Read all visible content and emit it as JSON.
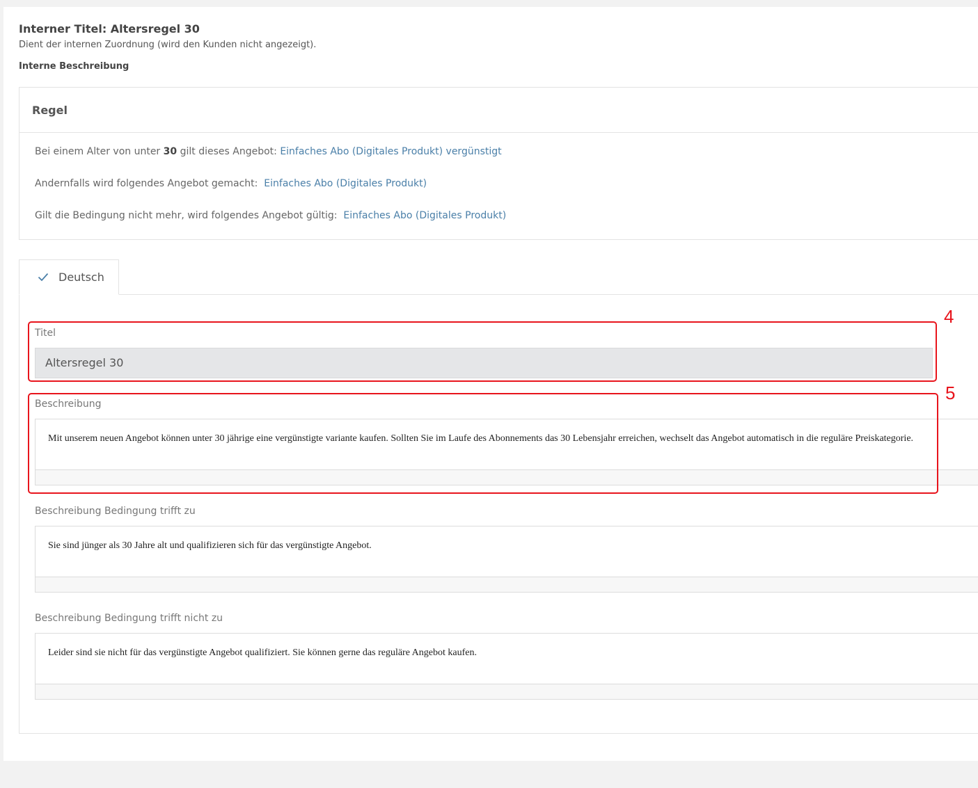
{
  "header": {
    "internal_title": "Interner Titel: Altersregel 30",
    "internal_title_hint": "Dient der internen Zuordnung (wird den Kunden nicht angezeigt).",
    "internal_description_label": "Interne Beschreibung"
  },
  "rule": {
    "heading": "Regel",
    "line1_prefix": "Bei einem Alter von unter",
    "line1_age": "30",
    "line1_mid": "gilt dieses Angebot:",
    "line1_link": "Einfaches Abo (Digitales Produkt) vergünstigt",
    "line2_text": "Andernfalls wird folgendes Angebot gemacht:",
    "line2_link": "Einfaches Abo (Digitales Produkt)",
    "line3_text": "Gilt die Bedingung nicht mehr, wird folgendes Angebot gültig:",
    "line3_link": "Einfaches Abo (Digitales Produkt)"
  },
  "tabs": [
    {
      "label": "Deutsch",
      "active": true
    }
  ],
  "form": {
    "title_label": "Titel",
    "title_value": "Altersregel 30",
    "description_label": "Beschreibung",
    "description_text": "Mit unserem neuen Angebot können unter 30 jährige eine vergünstigte variante kaufen. Sollten Sie im Laufe des Abonnements das 30 Lebensjahr erreichen, wechselt das Angebot automatisch in die reguläre Preiskategorie.",
    "cond_true_label": "Beschreibung Bedingung trifft zu",
    "cond_true_text": "Sie sind jünger als 30 Jahre alt und qualifizieren sich für das vergünstigte Angebot.",
    "cond_false_label": "Beschreibung Bedingung trifft nicht zu",
    "cond_false_text": "Leider sind sie nicht für das vergünstigte Angebot qualifiziert. Sie können gerne das reguläre Angebot kaufen."
  },
  "annotations": [
    {
      "number": "4"
    },
    {
      "number": "5"
    }
  ],
  "colors": {
    "link": "#4a7fa8",
    "annotation": "#e8141c",
    "check": "#4a7fa8"
  },
  "icons": {
    "tab_check": "checkmark-icon"
  }
}
